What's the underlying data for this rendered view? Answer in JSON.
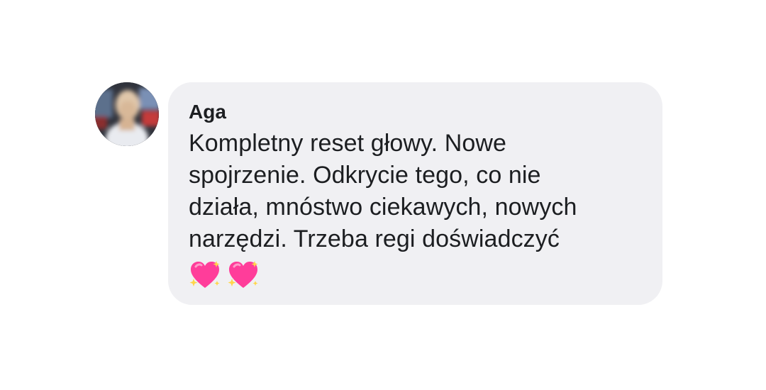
{
  "comment": {
    "author": "Aga",
    "text": "Kompletny reset głowy. Nowe\nspojrzenie. Odkrycie tego, co nie\ndziała, mnóstwo ciekawych, nowych\nnarzędzi. Trzeba regi doświadczyć",
    "emoji_icons": [
      "sparkling-heart-icon",
      "sparkling-heart-icon"
    ]
  },
  "colors": {
    "bubble_background": "#f0f0f3",
    "text": "#1c1e21",
    "heart": "#ff3d9a",
    "sparkle": "#ffd64a"
  }
}
